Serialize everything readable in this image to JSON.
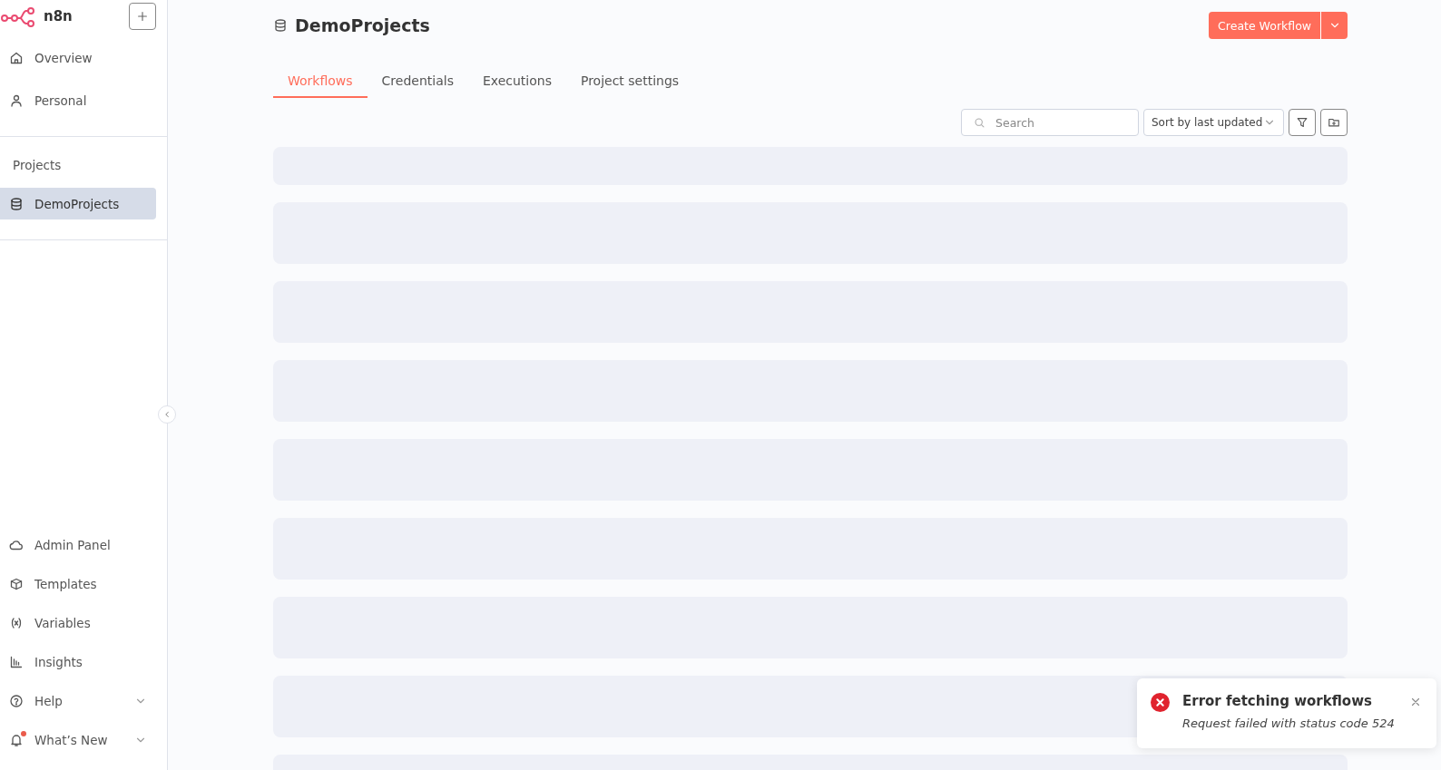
{
  "sidebar": {
    "logo_text": "n8n",
    "top_items": [
      {
        "label": "Overview",
        "selected": false
      },
      {
        "label": "Personal",
        "selected": false
      }
    ],
    "section_title": "Projects",
    "projects": [
      {
        "label": "DemoProjects",
        "selected": true
      }
    ],
    "bottom_items": [
      {
        "label": "Admin Panel",
        "kind": "link",
        "unread": false
      },
      {
        "label": "Templates",
        "kind": "link",
        "unread": false
      },
      {
        "label": "Variables",
        "kind": "link",
        "unread": false
      },
      {
        "label": "Insights",
        "kind": "link",
        "unread": false
      },
      {
        "label": "Help",
        "kind": "menu",
        "expanded": false,
        "unread": false
      },
      {
        "label": "What’s New",
        "kind": "menu",
        "expanded": false,
        "unread": true
      }
    ]
  },
  "header": {
    "title": "DemoProjects",
    "primary_button": "Create Workflow"
  },
  "tabs": [
    {
      "label": "Workflows",
      "selected": true
    },
    {
      "label": "Credentials",
      "selected": false
    },
    {
      "label": "Executions",
      "selected": false
    },
    {
      "label": "Project settings",
      "selected": false
    }
  ],
  "toolbar": {
    "search": {
      "placeholder": "Search"
    },
    "sort": {
      "value": "Sort by last updated"
    }
  },
  "list": [
    {
      "kind": "placeholder"
    },
    {
      "kind": "placeholder"
    },
    {
      "kind": "placeholder"
    },
    {
      "kind": "placeholder"
    },
    {
      "kind": "placeholder"
    },
    {
      "kind": "placeholder"
    },
    {
      "kind": "placeholder"
    },
    {
      "kind": "placeholder"
    },
    {
      "kind": "placeholder"
    }
  ],
  "toast": {
    "title": "Error fetching workflows",
    "message": "Request failed with status code 524"
  }
}
